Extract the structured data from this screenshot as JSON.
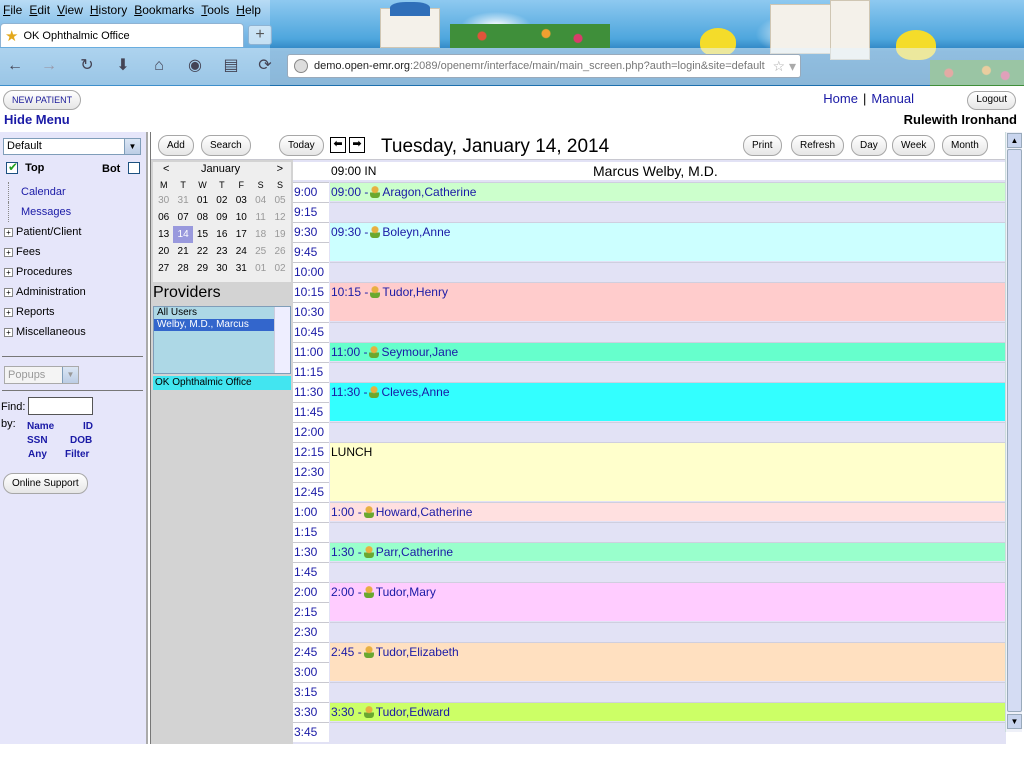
{
  "browser": {
    "menu": [
      "File",
      "Edit",
      "View",
      "History",
      "Bookmarks",
      "Tools",
      "Help"
    ],
    "tab_title": "OK Ophthalmic Office",
    "url_host": "demo.open-emr.org",
    "url_rest": ":2089/openemr/interface/main/main_screen.php?auth=login&site=default"
  },
  "header": {
    "new_patient": "NEW PATIENT",
    "hide_menu": "Hide Menu",
    "home": "Home",
    "separator": "|",
    "manual": "Manual",
    "logout": "Logout",
    "user": "Rulewith Ironhand"
  },
  "nav": {
    "profile": "Default",
    "top_label": "Top",
    "bot_label": "Bot",
    "items": [
      {
        "label": "Calendar"
      },
      {
        "label": "Messages"
      },
      {
        "label": "Patient/Client"
      },
      {
        "label": "Fees"
      },
      {
        "label": "Procedures"
      },
      {
        "label": "Administration"
      },
      {
        "label": "Reports"
      },
      {
        "label": "Miscellaneous"
      }
    ],
    "popups": "Popups",
    "find_label": "Find:",
    "by_label": "by:",
    "find_links": [
      "Name",
      "ID",
      "SSN",
      "DOB",
      "Any",
      "Filter"
    ],
    "online_support": "Online Support"
  },
  "toolbar": {
    "add": "Add",
    "search": "Search",
    "today": "Today",
    "date_title": "Tuesday, January 14, 2014",
    "print": "Print",
    "refresh": "Refresh",
    "day": "Day",
    "week": "Week",
    "month": "Month"
  },
  "minical": {
    "prev": "<",
    "next": ">",
    "month": "January",
    "dow": [
      "M",
      "T",
      "W",
      "T",
      "F",
      "S",
      "S"
    ],
    "weeks": [
      [
        "30",
        "31",
        "01",
        "02",
        "03",
        "04",
        "05"
      ],
      [
        "06",
        "07",
        "08",
        "09",
        "10",
        "11",
        "12"
      ],
      [
        "13",
        "14",
        "15",
        "16",
        "17",
        "18",
        "19"
      ],
      [
        "20",
        "21",
        "22",
        "23",
        "24",
        "25",
        "26"
      ],
      [
        "27",
        "28",
        "29",
        "30",
        "31",
        "01",
        "02"
      ]
    ],
    "today": "14"
  },
  "providers": {
    "title": "Providers",
    "options": [
      "All Users",
      "Welby, M.D., Marcus"
    ],
    "selected": "Welby, M.D., Marcus",
    "facility": "OK Ophthalmic Office"
  },
  "schedule": {
    "in_label": "09:00 IN",
    "provider": "Marcus Welby, M.D.",
    "times": [
      "9:00",
      "9:15",
      "9:30",
      "9:45",
      "10:00",
      "10:15",
      "10:30",
      "10:45",
      "11:00",
      "11:15",
      "11:30",
      "11:45",
      "12:00",
      "12:15",
      "12:30",
      "12:45",
      "1:00",
      "1:15",
      "1:30",
      "1:45",
      "2:00",
      "2:15",
      "2:30",
      "2:45",
      "3:00",
      "3:15",
      "3:30",
      "3:45"
    ],
    "appointments": [
      {
        "time": "09:00 -",
        "patient": "Aragon,Catherine",
        "slots": 1,
        "color": "#ccffcc"
      },
      {
        "time": "09:30 -",
        "patient": "Boleyn,Anne",
        "slots": 2,
        "color": "#ccffff"
      },
      {
        "time": "10:15 -",
        "patient": "Tudor,Henry",
        "slots": 2,
        "color": "#ffcccc"
      },
      {
        "time": "11:00 -",
        "patient": "Seymour,Jane",
        "slots": 1,
        "color": "#66ffcc"
      },
      {
        "time": "11:30 -",
        "patient": "Cleves,Anne",
        "slots": 2,
        "color": "#33ffff"
      },
      {
        "time": "",
        "patient": "LUNCH",
        "slots": 3,
        "color": "#ffffcc"
      },
      {
        "time": "1:00 -",
        "patient": "Howard,Catherine",
        "slots": 1,
        "color": "#ffe0e0"
      },
      {
        "time": "1:30 -",
        "patient": "Parr,Catherine",
        "slots": 1,
        "color": "#99ffcc"
      },
      {
        "time": "2:00 -",
        "patient": "Tudor,Mary",
        "slots": 2,
        "color": "#ffccff"
      },
      {
        "time": "2:45 -",
        "patient": "Tudor,Elizabeth",
        "slots": 2,
        "color": "#ffe0c0"
      },
      {
        "time": "3:30 -",
        "patient": "Tudor,Edward",
        "slots": 1,
        "color": "#ccff66"
      }
    ]
  }
}
